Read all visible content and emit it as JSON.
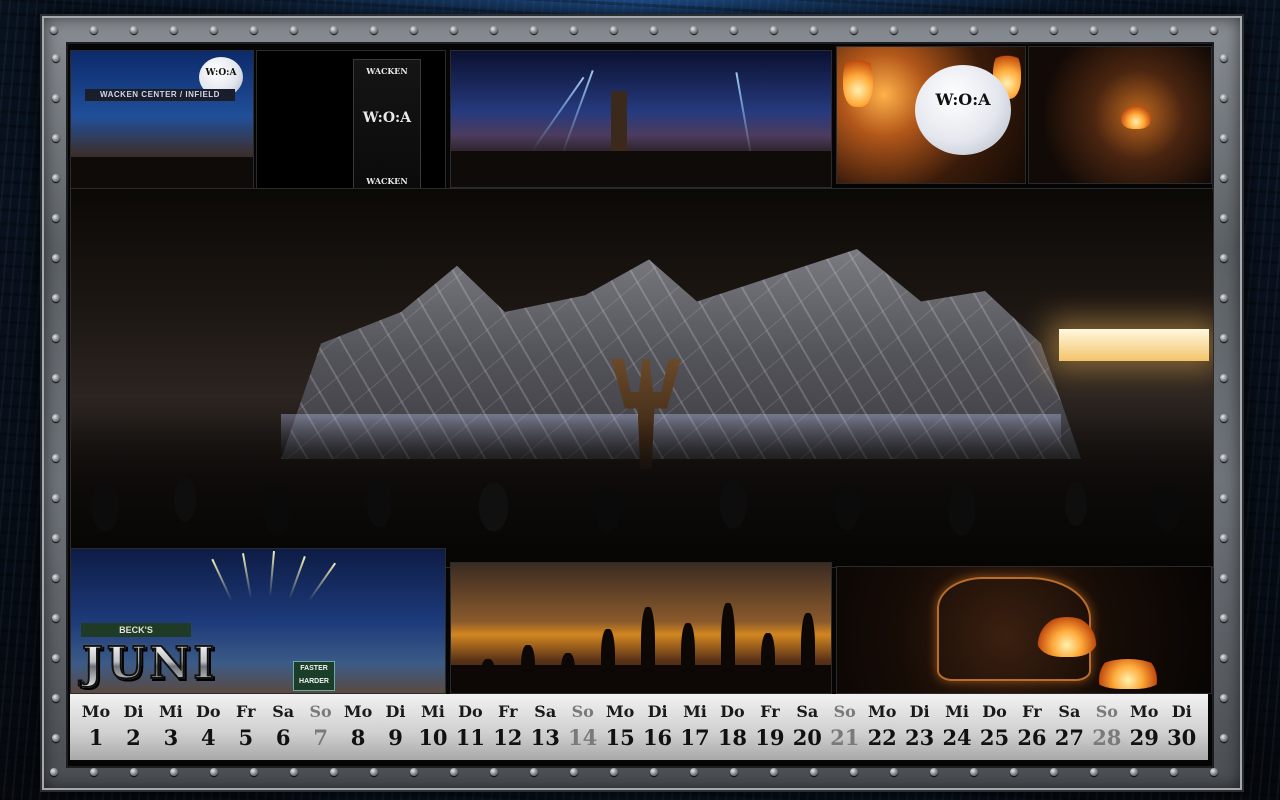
{
  "month": "JUNI",
  "photos": {
    "gate_banner": "WACKEN CENTER / INFIELD",
    "balloon_logo": "W:O:A",
    "balloon_small": "W:O:A",
    "tower_logo": "W:O:A",
    "tower_top": "WACKEN",
    "tower_bottom": "WACKEN",
    "beck_sign": "BECK'S",
    "faster_sign": "FASTER HARDER"
  },
  "calendar": [
    {
      "day": "Mo",
      "num": "1",
      "sunday": false
    },
    {
      "day": "Di",
      "num": "2",
      "sunday": false
    },
    {
      "day": "Mi",
      "num": "3",
      "sunday": false
    },
    {
      "day": "Do",
      "num": "4",
      "sunday": false
    },
    {
      "day": "Fr",
      "num": "5",
      "sunday": false
    },
    {
      "day": "Sa",
      "num": "6",
      "sunday": false
    },
    {
      "day": "So",
      "num": "7",
      "sunday": true
    },
    {
      "day": "Mo",
      "num": "8",
      "sunday": false
    },
    {
      "day": "Di",
      "num": "9",
      "sunday": false
    },
    {
      "day": "Mi",
      "num": "10",
      "sunday": false
    },
    {
      "day": "Do",
      "num": "11",
      "sunday": false
    },
    {
      "day": "Fr",
      "num": "12",
      "sunday": false
    },
    {
      "day": "Sa",
      "num": "13",
      "sunday": false
    },
    {
      "day": "So",
      "num": "14",
      "sunday": true
    },
    {
      "day": "Mo",
      "num": "15",
      "sunday": false
    },
    {
      "day": "Di",
      "num": "16",
      "sunday": false
    },
    {
      "day": "Mi",
      "num": "17",
      "sunday": false
    },
    {
      "day": "Do",
      "num": "18",
      "sunday": false
    },
    {
      "day": "Fr",
      "num": "19",
      "sunday": false
    },
    {
      "day": "Sa",
      "num": "20",
      "sunday": false
    },
    {
      "day": "So",
      "num": "21",
      "sunday": true
    },
    {
      "day": "Mo",
      "num": "22",
      "sunday": false
    },
    {
      "day": "Di",
      "num": "23",
      "sunday": false
    },
    {
      "day": "Mi",
      "num": "24",
      "sunday": false
    },
    {
      "day": "Do",
      "num": "25",
      "sunday": false
    },
    {
      "day": "Fr",
      "num": "26",
      "sunday": false
    },
    {
      "day": "Sa",
      "num": "27",
      "sunday": false
    },
    {
      "day": "So",
      "num": "28",
      "sunday": true
    },
    {
      "day": "Mo",
      "num": "29",
      "sunday": false
    },
    {
      "day": "Di",
      "num": "30",
      "sunday": false
    }
  ],
  "colors": {
    "weekday": "#111111",
    "sunday": "#7a7a7a",
    "frame": "#6f747a"
  }
}
